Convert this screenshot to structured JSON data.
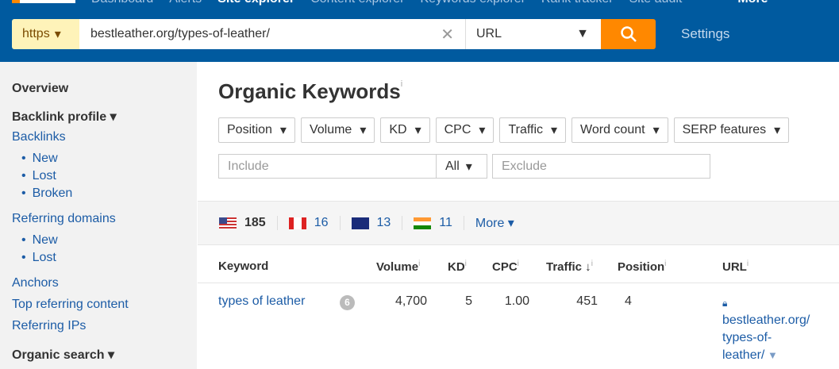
{
  "nav": {
    "items": [
      "Dashboard",
      "Alerts",
      "Site explorer",
      "Content explorer",
      "Keywords explorer",
      "Rank tracker",
      "Site audit"
    ],
    "more": "More"
  },
  "search": {
    "protocol": "https",
    "url": "bestleather.org/types-of-leather/",
    "mode": "URL",
    "settings": "Settings"
  },
  "sidebar": {
    "overview": "Overview",
    "backlink_profile": "Backlink profile ▾",
    "backlinks": "Backlinks",
    "bl_new": "New",
    "bl_lost": "Lost",
    "bl_broken": "Broken",
    "referring_domains": "Referring domains",
    "rd_new": "New",
    "rd_lost": "Lost",
    "anchors": "Anchors",
    "top_referring": "Top referring content",
    "referring_ips": "Referring IPs",
    "organic_search": "Organic search ▾"
  },
  "main": {
    "title": "Organic Keywords",
    "info": "i",
    "filters": [
      "Position",
      "Volume",
      "KD",
      "CPC",
      "Traffic",
      "Word count",
      "SERP features"
    ],
    "include_placeholder": "Include",
    "all": "All",
    "exclude_placeholder": "Exclude",
    "countries": [
      {
        "code": "us",
        "count": "185"
      },
      {
        "code": "ca",
        "count": "16"
      },
      {
        "code": "au",
        "count": "13"
      },
      {
        "code": "in",
        "count": "11"
      }
    ],
    "more": "More ▾",
    "columns": [
      "Keyword",
      "Volume",
      "KD",
      "CPC",
      "Traffic",
      "Position",
      "URL"
    ],
    "row": {
      "keyword": "types of leather",
      "serp_badge": "6",
      "volume": "4,700",
      "kd": "5",
      "cpc": "1.00",
      "traffic": "451",
      "position": "4",
      "url_lines": [
        "bestleather.org/",
        "types-of-",
        "leather/"
      ]
    }
  },
  "colors": {
    "header": "#005a9f",
    "accent": "#ff8800",
    "link": "#1c5ca6"
  }
}
